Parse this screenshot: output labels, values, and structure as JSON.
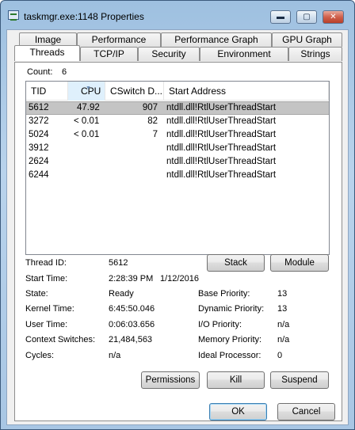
{
  "window": {
    "title": "taskmgr.exe:1148 Properties",
    "min_glyph": "▬",
    "max_glyph": "▢",
    "close_glyph": "✕"
  },
  "tabs": {
    "back_row": [
      "Image",
      "Performance",
      "Performance Graph",
      "GPU Graph"
    ],
    "front_row": [
      "Threads",
      "TCP/IP",
      "Security",
      "Environment",
      "Strings"
    ],
    "active": "Threads"
  },
  "count": {
    "label": "Count:",
    "value": "6"
  },
  "thread_list": {
    "columns": [
      "TID",
      "CPU",
      "CSwitch D...",
      "Start Address"
    ],
    "sorted_column": "CPU",
    "rows": [
      {
        "tid": "5612",
        "cpu": "47.92",
        "cswitch": "907",
        "start": "ntdll.dll!RtlUserThreadStart",
        "selected": true
      },
      {
        "tid": "3272",
        "cpu": "< 0.01",
        "cswitch": "82",
        "start": "ntdll.dll!RtlUserThreadStart",
        "selected": false
      },
      {
        "tid": "5024",
        "cpu": "< 0.01",
        "cswitch": "7",
        "start": "ntdll.dll!RtlUserThreadStart",
        "selected": false
      },
      {
        "tid": "3912",
        "cpu": "",
        "cswitch": "",
        "start": "ntdll.dll!RtlUserThreadStart",
        "selected": false
      },
      {
        "tid": "2624",
        "cpu": "",
        "cswitch": "",
        "start": "ntdll.dll!RtlUserThreadStart",
        "selected": false
      },
      {
        "tid": "6244",
        "cpu": "",
        "cswitch": "",
        "start": "ntdll.dll!RtlUserThreadStart",
        "selected": false
      }
    ]
  },
  "details": {
    "thread_id": {
      "label": "Thread ID:",
      "value": "5612"
    },
    "start_time": {
      "label": "Start Time:",
      "time": "2:28:39 PM",
      "date": "1/12/2016"
    },
    "state": {
      "label": "State:",
      "value": "Ready"
    },
    "kernel_time": {
      "label": "Kernel Time:",
      "value": "6:45:50.046"
    },
    "user_time": {
      "label": "User Time:",
      "value": "0:06:03.656"
    },
    "context_switches": {
      "label": "Context Switches:",
      "value": "21,484,563"
    },
    "cycles": {
      "label": "Cycles:",
      "value": "n/a"
    },
    "base_priority": {
      "label": "Base Priority:",
      "value": "13"
    },
    "dynamic_priority": {
      "label": "Dynamic Priority:",
      "value": "13"
    },
    "io_priority": {
      "label": "I/O Priority:",
      "value": "n/a"
    },
    "memory_priority": {
      "label": "Memory Priority:",
      "value": "n/a"
    },
    "ideal_processor": {
      "label": "Ideal Processor:",
      "value": "0"
    }
  },
  "buttons": {
    "stack": "Stack",
    "module": "Module",
    "permissions": "Permissions",
    "kill": "Kill",
    "suspend": "Suspend",
    "ok": "OK",
    "cancel": "Cancel"
  }
}
